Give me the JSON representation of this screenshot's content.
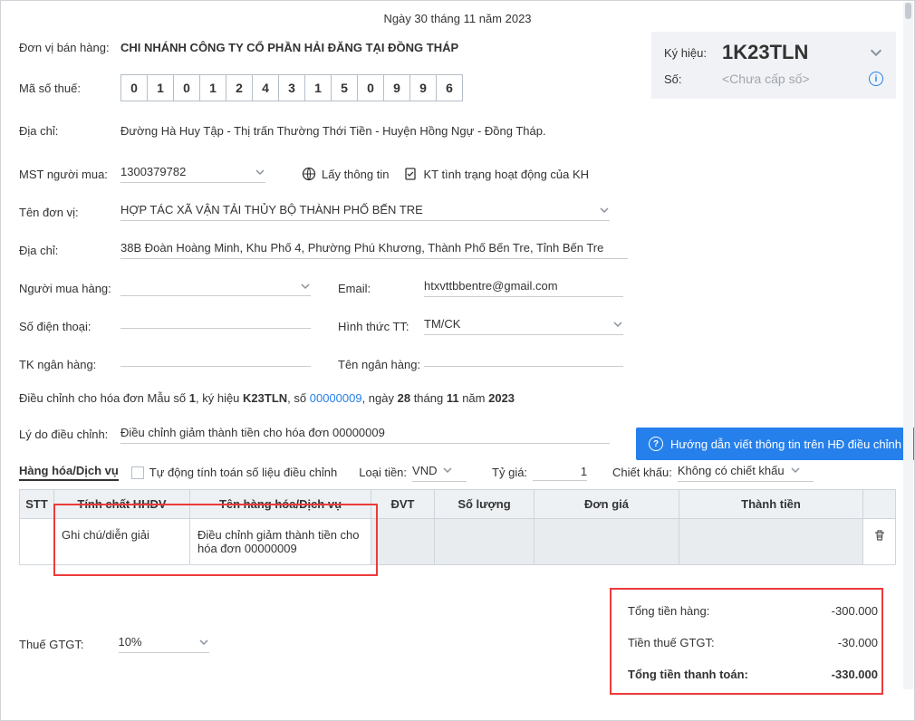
{
  "date_line": "Ngày 30 tháng 11 năm 2023",
  "seller": {
    "unit_label": "Đơn vị bán hàng:",
    "unit_value": "CHI NHÁNH CÔNG TY CỔ PHẦN HẢI ĐĂNG TẠI ĐỒNG THÁP",
    "tax_label": "Mã số thuế:",
    "tax_digits": [
      "0",
      "1",
      "0",
      "1",
      "2",
      "4",
      "3",
      "1",
      "5",
      "0",
      "9",
      "9",
      "6"
    ],
    "address_label": "Địa chỉ:",
    "address_value": "Đường Hà Huy Tập - Thị trấn Thường Thới Tiền - Huyện Hồng Ngự - Đồng Tháp."
  },
  "serial": {
    "kyhieu_label": "Ký hiệu:",
    "kyhieu_value": "1K23TLN",
    "so_label": "Số:",
    "so_placeholder": "<Chưa cấp số>"
  },
  "buyer": {
    "mst_label": "MST người mua:",
    "mst_value": "1300379782",
    "get_info_label": "Lấy thông tin",
    "check_status_label": "KT tình trạng hoạt động của KH",
    "unit_label": "Tên đơn vị:",
    "unit_value": "HỢP TÁC XÃ VẬN TẢI THỦY BỘ THÀNH PHỐ BẾN TRE",
    "address_label": "Địa chỉ:",
    "address_value": "38B Đoàn Hoàng Minh, Khu Phố 4, Phường Phú Khương, Thành Phố Bến Tre, Tỉnh Bến Tre",
    "buyer_name_label": "Người mua hàng:",
    "buyer_name_value": "",
    "email_label": "Email:",
    "email_value": "htxvttbbentre@gmail.com",
    "phone_label": "Số điện thoại:",
    "phone_value": "",
    "payment_label": "Hình thức TT:",
    "payment_value": "TM/CK",
    "bank_acc_label": "TK ngân hàng:",
    "bank_acc_value": "",
    "bank_name_label": "Tên ngân hàng:",
    "bank_name_value": ""
  },
  "adjust": {
    "text_prefix": "Điều chỉnh cho hóa đơn Mẫu số ",
    "mau": "1",
    "text_mid1": ", ký hiệu ",
    "kyhieu": "K23TLN",
    "text_mid2": ", số ",
    "so": "00000009",
    "text_mid3": ", ngày ",
    "day": "28",
    "text_mid4": " tháng ",
    "month": "11",
    "text_mid5": " năm ",
    "year": "2023",
    "reason_label": "Lý do điều chỉnh:",
    "reason_value": "Điều chỉnh giảm thành tiền cho hóa đơn 00000009",
    "guide_label": "Hướng dẫn viết thông tin trên HĐ điều chỉnh"
  },
  "items_section": {
    "title": "Hàng hóa/Dịch vụ",
    "auto_calc_label": "Tự động tính toán số liệu điều chỉnh",
    "loai_tien_label": "Loại tiền:",
    "loai_tien_value": "VND",
    "ty_gia_label": "Tỷ giá:",
    "ty_gia_value": "1",
    "chiet_khau_label": "Chiết khấu:",
    "chiet_khau_value": "Không có chiết khấu",
    "headers": {
      "stt": "STT",
      "tinh_chat": "Tính chất HHDV",
      "ten": "Tên hàng hóa/Dịch vụ",
      "dvt": "ĐVT",
      "so_luong": "Số lượng",
      "don_gia": "Đơn giá",
      "thanh_tien": "Thành tiền"
    },
    "rows": [
      {
        "stt": "",
        "tinh_chat": "Ghi chú/diễn giải",
        "ten": "Điều chỉnh giảm thành tiền cho hóa đơn 00000009",
        "dvt": "",
        "so_luong": "",
        "don_gia": "",
        "thanh_tien": ""
      }
    ]
  },
  "vat": {
    "label": "Thuế GTGT:",
    "value": "10%"
  },
  "totals": {
    "tong_hang_label": "Tổng tiền hàng:",
    "tong_hang_value": "-300.000",
    "thue_label": "Tiền thuế GTGT:",
    "thue_value": "-30.000",
    "thanh_toan_label": "Tổng tiền thanh toán:",
    "thanh_toan_value": "-330.000"
  }
}
